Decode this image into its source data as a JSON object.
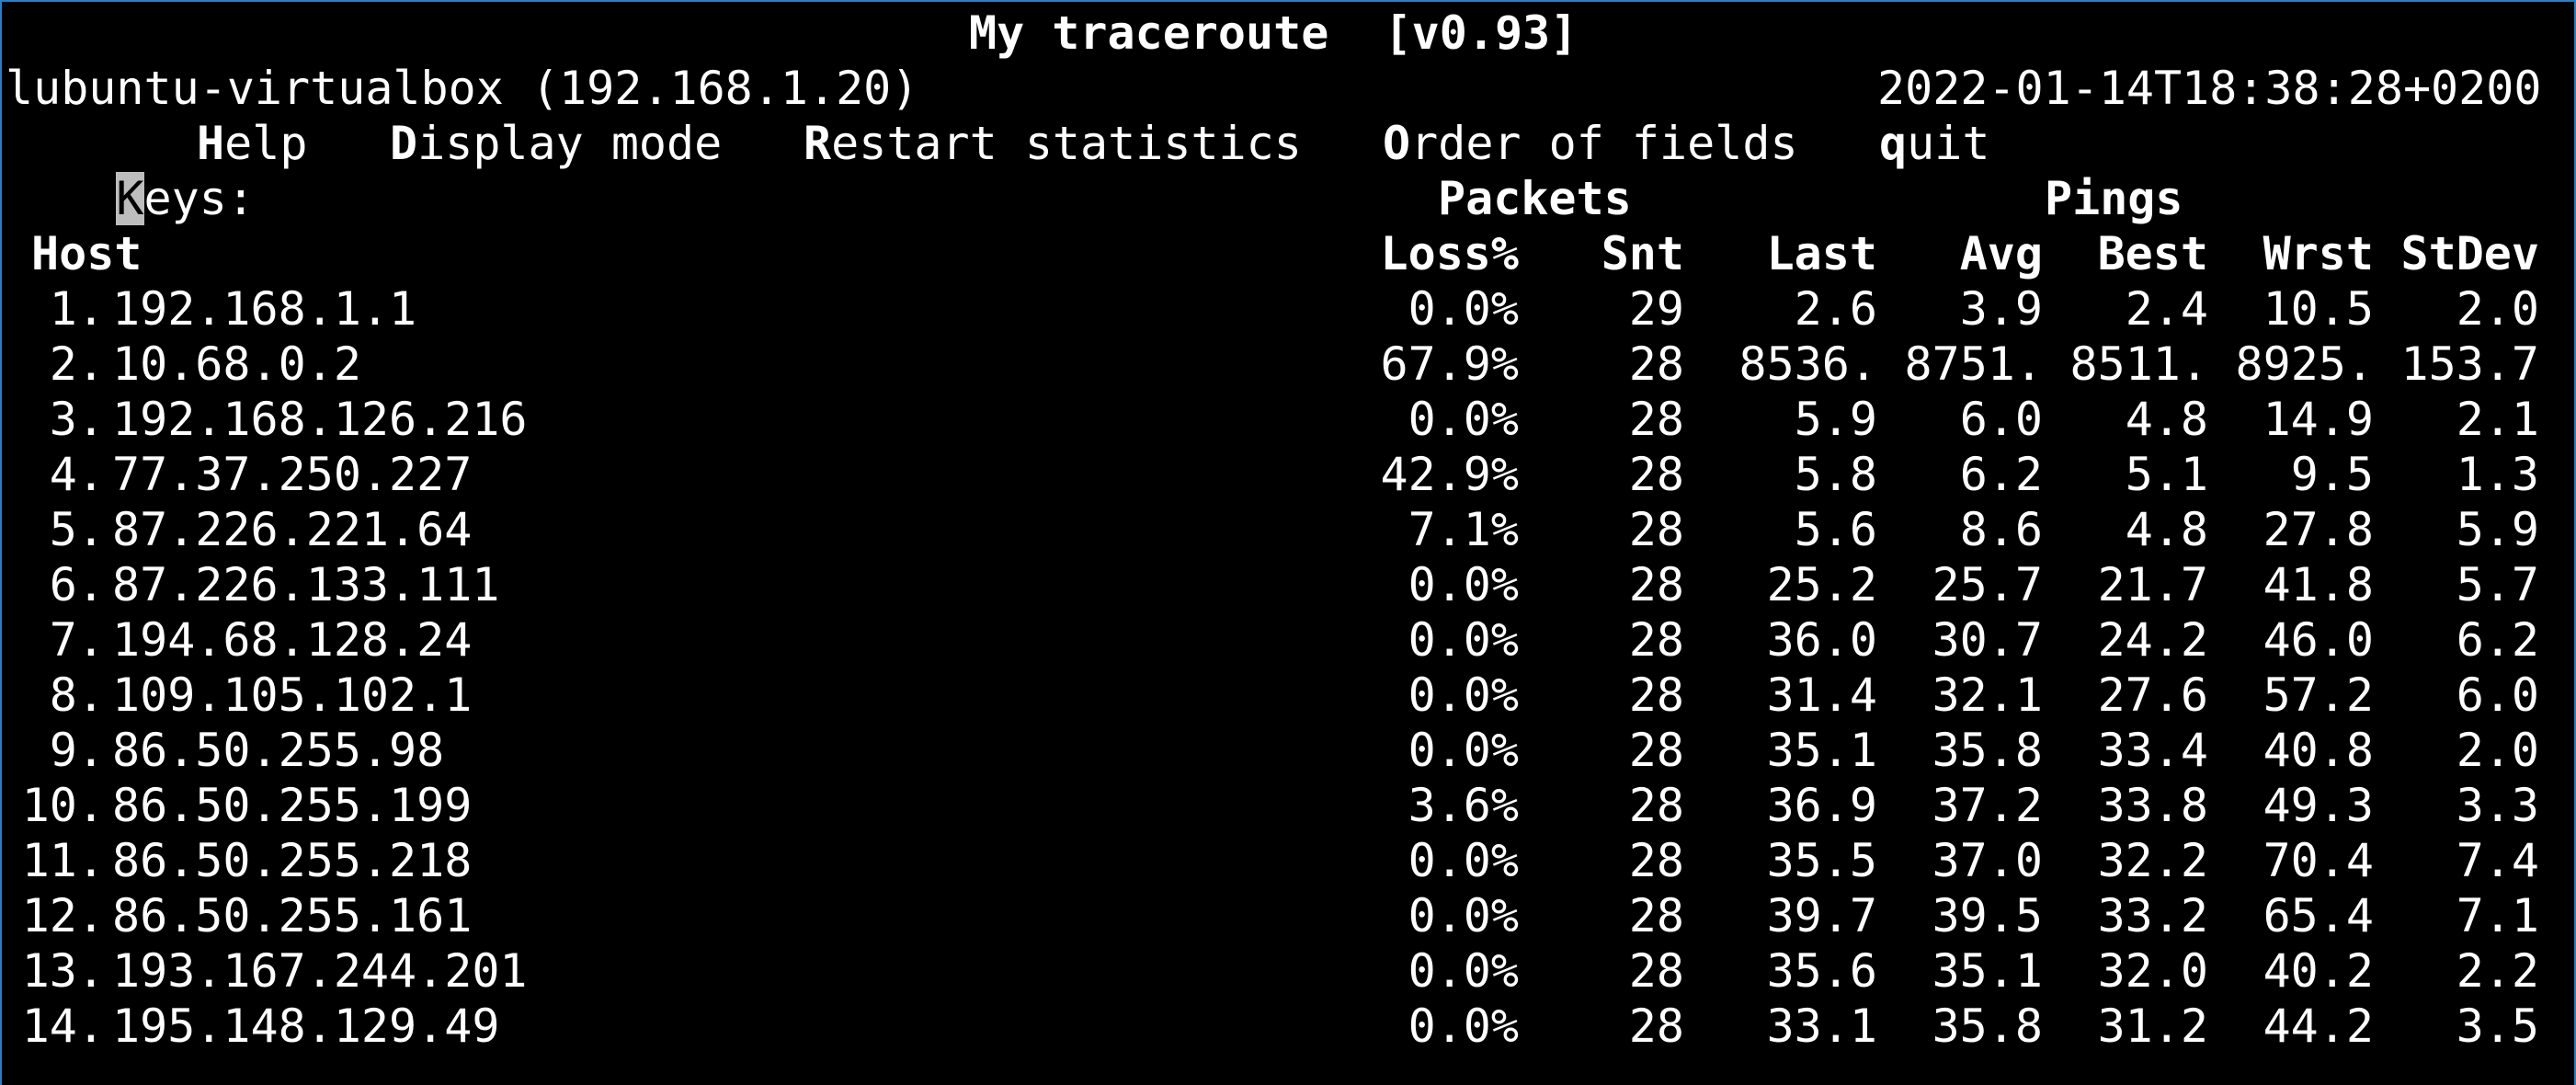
{
  "header": {
    "title": "My traceroute  [v0.93]",
    "host_info": "lubuntu-virtualbox (192.168.1.20)",
    "timestamp": "2022-01-14T18:38:28+0200"
  },
  "keys": {
    "label_cursor": "K",
    "label_rest": "eys:",
    "items": [
      {
        "key": "H",
        "rest": "elp"
      },
      {
        "key": "D",
        "rest": "isplay mode"
      },
      {
        "key": "R",
        "rest": "estart statistics"
      },
      {
        "key": "O",
        "rest": "rder of fields"
      },
      {
        "key": "q",
        "rest": "uit"
      }
    ]
  },
  "group_headers": {
    "packets": "Packets",
    "pings": "Pings"
  },
  "columns": {
    "host": "Host",
    "loss": "Loss%",
    "snt": "Snt",
    "last": "Last",
    "avg": "Avg",
    "best": "Best",
    "wrst": "Wrst",
    "stdev": "StDev"
  },
  "hops": [
    {
      "num": "1.",
      "host": "192.168.1.1",
      "loss": "0.0%",
      "snt": "29",
      "last": "2.6",
      "avg": "3.9",
      "best": "2.4",
      "wrst": "10.5",
      "stdev": "2.0"
    },
    {
      "num": "2.",
      "host": "10.68.0.2",
      "loss": "67.9%",
      "snt": "28",
      "last": "8536.",
      "avg": "8751.",
      "best": "8511.",
      "wrst": "8925.",
      "stdev": "153.7"
    },
    {
      "num": "3.",
      "host": "192.168.126.216",
      "loss": "0.0%",
      "snt": "28",
      "last": "5.9",
      "avg": "6.0",
      "best": "4.8",
      "wrst": "14.9",
      "stdev": "2.1"
    },
    {
      "num": "4.",
      "host": "77.37.250.227",
      "loss": "42.9%",
      "snt": "28",
      "last": "5.8",
      "avg": "6.2",
      "best": "5.1",
      "wrst": "9.5",
      "stdev": "1.3"
    },
    {
      "num": "5.",
      "host": "87.226.221.64",
      "loss": "7.1%",
      "snt": "28",
      "last": "5.6",
      "avg": "8.6",
      "best": "4.8",
      "wrst": "27.8",
      "stdev": "5.9"
    },
    {
      "num": "6.",
      "host": "87.226.133.111",
      "loss": "0.0%",
      "snt": "28",
      "last": "25.2",
      "avg": "25.7",
      "best": "21.7",
      "wrst": "41.8",
      "stdev": "5.7"
    },
    {
      "num": "7.",
      "host": "194.68.128.24",
      "loss": "0.0%",
      "snt": "28",
      "last": "36.0",
      "avg": "30.7",
      "best": "24.2",
      "wrst": "46.0",
      "stdev": "6.2"
    },
    {
      "num": "8.",
      "host": "109.105.102.1",
      "loss": "0.0%",
      "snt": "28",
      "last": "31.4",
      "avg": "32.1",
      "best": "27.6",
      "wrst": "57.2",
      "stdev": "6.0"
    },
    {
      "num": "9.",
      "host": "86.50.255.98",
      "loss": "0.0%",
      "snt": "28",
      "last": "35.1",
      "avg": "35.8",
      "best": "33.4",
      "wrst": "40.8",
      "stdev": "2.0"
    },
    {
      "num": "10.",
      "host": "86.50.255.199",
      "loss": "3.6%",
      "snt": "28",
      "last": "36.9",
      "avg": "37.2",
      "best": "33.8",
      "wrst": "49.3",
      "stdev": "3.3"
    },
    {
      "num": "11.",
      "host": "86.50.255.218",
      "loss": "0.0%",
      "snt": "28",
      "last": "35.5",
      "avg": "37.0",
      "best": "32.2",
      "wrst": "70.4",
      "stdev": "7.4"
    },
    {
      "num": "12.",
      "host": "86.50.255.161",
      "loss": "0.0%",
      "snt": "28",
      "last": "39.7",
      "avg": "39.5",
      "best": "33.2",
      "wrst": "65.4",
      "stdev": "7.1"
    },
    {
      "num": "13.",
      "host": "193.167.244.201",
      "loss": "0.0%",
      "snt": "28",
      "last": "35.6",
      "avg": "35.1",
      "best": "32.0",
      "wrst": "40.2",
      "stdev": "2.2"
    },
    {
      "num": "14.",
      "host": "195.148.129.49",
      "loss": "0.0%",
      "snt": "28",
      "last": "33.1",
      "avg": "35.8",
      "best": "31.2",
      "wrst": "44.2",
      "stdev": "3.5"
    }
  ],
  "colors": {
    "background": "#000000",
    "foreground": "#ffffff",
    "cursor": "#bdbdbd",
    "window_border": "#2f7ebf"
  }
}
